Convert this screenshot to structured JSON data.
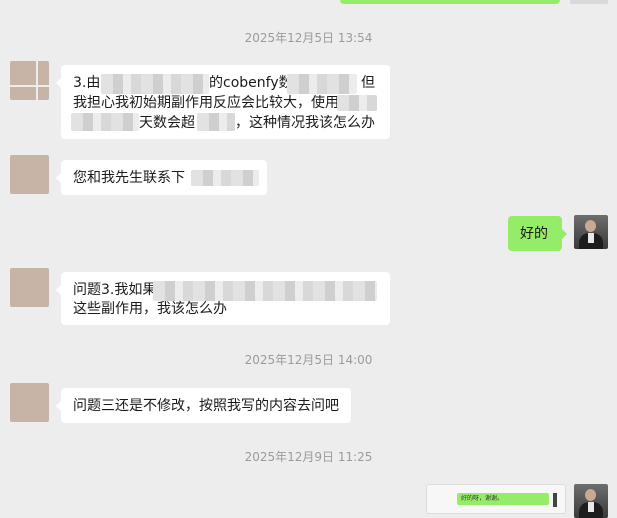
{
  "timestamps": [
    "2025年12月5日 13:54",
    "2025年12月5日 14:00",
    "2025年12月9日 11:25"
  ],
  "messages": [
    {
      "sender": "contact",
      "lines": [
        "3.由",
        "的cobenfy数",
        "但",
        "我担心我初始期副作用反应会比较大，使用",
        "天数会超",
        "，这种情况我该怎么办"
      ]
    },
    {
      "sender": "contact",
      "lines": [
        "您和我先生联系下"
      ]
    },
    {
      "sender": "me",
      "lines": [
        "好的"
      ]
    },
    {
      "sender": "contact",
      "lines": [
        "问题3.我如果",
        "这些副作用，我该怎么办"
      ]
    },
    {
      "sender": "contact",
      "lines": [
        "问题三还是不修改，按照我写的内容去问吧"
      ]
    },
    {
      "sender": "me",
      "lines": [
        "好的呀，谢谢。"
      ]
    }
  ],
  "icons": {
    "contact_avatar": "blurred-avatar-icon",
    "my_avatar": "portrait-avatar-icon"
  },
  "colors": {
    "background": "#ededed",
    "sent_bubble": "#95ec69",
    "received_bubble": "#ffffff"
  }
}
